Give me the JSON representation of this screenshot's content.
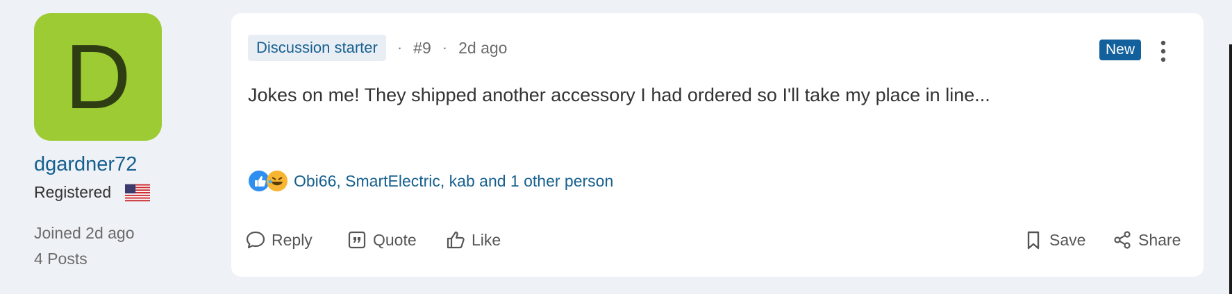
{
  "user": {
    "avatar_letter": "D",
    "avatar_color": "#9dcb34",
    "username": "dgardner72",
    "role": "Registered",
    "flag_icon": "us-flag-icon",
    "joined": "Joined 2d ago",
    "posts": "4 Posts"
  },
  "post": {
    "starter_badge": "Discussion starter",
    "separator": "·",
    "number": "#9",
    "time": "2d ago",
    "new_badge": "New",
    "body": "Jokes on me! They shipped another accessory I had ordered so I'll take my place in line...",
    "reactions": {
      "icons": [
        "like-emoji-icon",
        "laughing-emoji-icon"
      ],
      "names": "Obi66, SmartElectric, kab and 1 other person"
    }
  },
  "actions": {
    "reply": "Reply",
    "quote": "Quote",
    "like": "Like",
    "save": "Save",
    "share": "Share"
  },
  "colors": {
    "link": "#16608f",
    "new_badge": "#12609c",
    "background": "#eef1f5"
  }
}
